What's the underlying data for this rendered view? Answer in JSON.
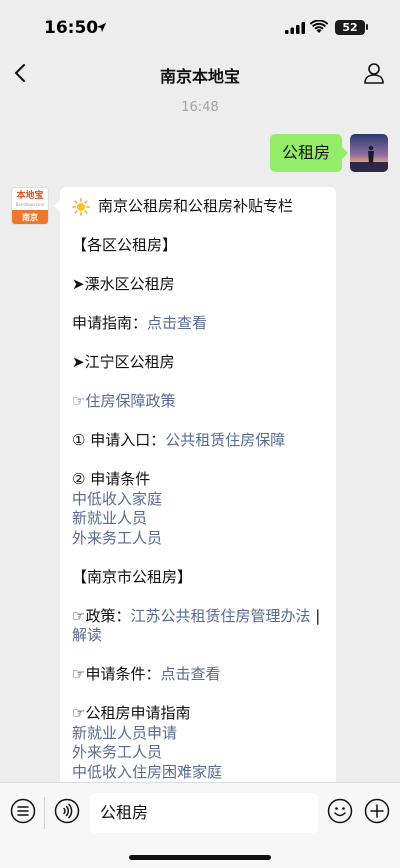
{
  "status_bar": {
    "time": "16:50",
    "battery": "52"
  },
  "nav": {
    "title": "南京本地宝"
  },
  "chat": {
    "timestamp": "16:48",
    "my_message": "公租房",
    "their_avatar": {
      "logo_text": "本地宝",
      "logo_domain": "Bendibao.com",
      "city": "南京"
    },
    "reply": {
      "title": "南京公租房和公租房补贴专栏",
      "section_districts": "【各区公租房】",
      "lishui_heading": "➤溧水区公租房",
      "apply_guide_label": "申请指南：",
      "apply_guide_link": "点击查看",
      "jiangning_heading": "➤江宁区公租房",
      "housing_policy_link": "☞住房保障政策",
      "entry_label": "① 申请入口：",
      "entry_link": "公共租赁住房保障",
      "conditions_label": "② 申请条件",
      "cond_1": "中低收入家庭",
      "cond_2": "新就业人员",
      "cond_3": "外来务工人员",
      "section_city": "【南京市公租房】",
      "policy_label": "☞政策：",
      "policy_link": "江苏公共租赁住房管理办法",
      "policy_sep": " | ",
      "policy_explain": "解读",
      "city_cond_label": "☞申请条件：",
      "city_cond_link": "点击查看",
      "guide_heading": "☞公租房申请指南",
      "guide_1": "新就业人员申请",
      "guide_2": "外来务工人员",
      "guide_3": "中低收入住房困难家庭"
    }
  },
  "input": {
    "value": "公租房"
  }
}
